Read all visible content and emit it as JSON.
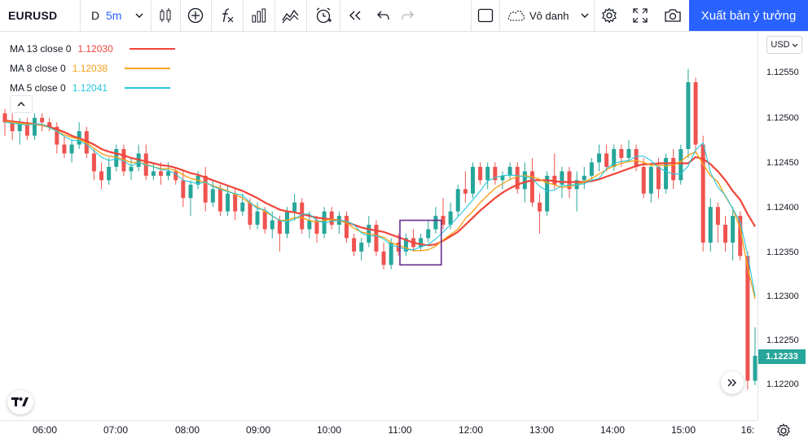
{
  "toolbar": {
    "symbol": "EURUSD",
    "interval_d": "D",
    "interval_5m": "5m",
    "layout_name": "Vô danh",
    "publish_label": "Xuất bản ý tưởng",
    "icons": [
      "candles-icon",
      "add-indicator-icon",
      "fx-icon",
      "bar-chart-icon",
      "compare-icon",
      "alert-clock-icon",
      "replay-icon",
      "undo-icon",
      "redo-icon",
      "square-icon",
      "cloud-icon",
      "settings-icon",
      "fullscreen-icon",
      "camera-icon"
    ]
  },
  "legend": [
    {
      "name": "MA 13 close 0",
      "value": "1.12030",
      "color": "#f0453a"
    },
    {
      "name": "MA 8 close 0",
      "value": "1.12038",
      "color": "#f7a21b"
    },
    {
      "name": "MA 5 close 0",
      "value": "1.12041",
      "color": "#26c6da"
    }
  ],
  "price_axis": {
    "currency": "USD",
    "labels": [
      "1.12550",
      "1.12500",
      "1.12450",
      "1.12400",
      "1.12350",
      "1.12300",
      "1.12250",
      "1.12200"
    ],
    "last_price": "1.12233",
    "last_price_color": "#26a69a"
  },
  "time_axis": {
    "labels": [
      "06:00",
      "07:00",
      "08:00",
      "09:00",
      "10:00",
      "11:00",
      "12:00",
      "13:00",
      "14:00",
      "15:00",
      "16:"
    ]
  },
  "chart_data": {
    "type": "candlestick",
    "symbol": "EURUSD",
    "interval": "5m",
    "ylim": [
      1.1218,
      1.1258
    ],
    "up_color": "#26a69a",
    "down_color": "#ef5350",
    "ohlc": [
      [
        1.12505,
        1.1251,
        1.1248,
        1.12495
      ],
      [
        1.12495,
        1.12505,
        1.12475,
        1.12485
      ],
      [
        1.12485,
        1.125,
        1.1247,
        1.12495
      ],
      [
        1.12495,
        1.125,
        1.12475,
        1.1248
      ],
      [
        1.1248,
        1.12505,
        1.12475,
        1.125
      ],
      [
        1.125,
        1.12505,
        1.12485,
        1.12495
      ],
      [
        1.12495,
        1.125,
        1.12485,
        1.1249
      ],
      [
        1.1249,
        1.12495,
        1.1246,
        1.1247
      ],
      [
        1.1247,
        1.1248,
        1.12455,
        1.1246
      ],
      [
        1.1246,
        1.12475,
        1.1245,
        1.1247
      ],
      [
        1.1247,
        1.12495,
        1.12465,
        1.12485
      ],
      [
        1.12485,
        1.1249,
        1.12455,
        1.1246
      ],
      [
        1.1246,
        1.12465,
        1.1243,
        1.1244
      ],
      [
        1.1244,
        1.1245,
        1.1242,
        1.1243
      ],
      [
        1.1243,
        1.12455,
        1.12425,
        1.12445
      ],
      [
        1.12445,
        1.1247,
        1.1244,
        1.12465
      ],
      [
        1.12465,
        1.1247,
        1.12435,
        1.1244
      ],
      [
        1.1244,
        1.12455,
        1.1243,
        1.12445
      ],
      [
        1.12445,
        1.1247,
        1.1244,
        1.1246
      ],
      [
        1.1246,
        1.1247,
        1.1243,
        1.12435
      ],
      [
        1.12435,
        1.1245,
        1.1243,
        1.1244
      ],
      [
        1.1244,
        1.1245,
        1.12425,
        1.12435
      ],
      [
        1.12435,
        1.1245,
        1.1243,
        1.1244
      ],
      [
        1.1244,
        1.12445,
        1.12425,
        1.1243
      ],
      [
        1.1243,
        1.1244,
        1.124,
        1.1241
      ],
      [
        1.1241,
        1.1243,
        1.1239,
        1.12425
      ],
      [
        1.12425,
        1.1244,
        1.1242,
        1.12435
      ],
      [
        1.12435,
        1.12445,
        1.12395,
        1.12405
      ],
      [
        1.12405,
        1.1243,
        1.124,
        1.1242
      ],
      [
        1.1242,
        1.12425,
        1.1239,
        1.12395
      ],
      [
        1.12395,
        1.12425,
        1.1239,
        1.12415
      ],
      [
        1.12415,
        1.1242,
        1.12385,
        1.12395
      ],
      [
        1.12395,
        1.12415,
        1.1239,
        1.12405
      ],
      [
        1.12405,
        1.1241,
        1.12375,
        1.1238
      ],
      [
        1.1238,
        1.12405,
        1.12375,
        1.12395
      ],
      [
        1.12395,
        1.124,
        1.1237,
        1.12375
      ],
      [
        1.12375,
        1.12395,
        1.12365,
        1.12385
      ],
      [
        1.12385,
        1.1239,
        1.1235,
        1.1237
      ],
      [
        1.1237,
        1.124,
        1.12365,
        1.12395
      ],
      [
        1.12395,
        1.12415,
        1.12385,
        1.12405
      ],
      [
        1.12405,
        1.1241,
        1.1237,
        1.12375
      ],
      [
        1.12375,
        1.12395,
        1.12365,
        1.12385
      ],
      [
        1.12385,
        1.1239,
        1.1236,
        1.1237
      ],
      [
        1.1237,
        1.124,
        1.12365,
        1.12395
      ],
      [
        1.12395,
        1.124,
        1.12375,
        1.1238
      ],
      [
        1.1238,
        1.12395,
        1.1237,
        1.1239
      ],
      [
        1.1239,
        1.12395,
        1.1236,
        1.12365
      ],
      [
        1.12365,
        1.1237,
        1.12345,
        1.1235
      ],
      [
        1.1235,
        1.12365,
        1.1234,
        1.1236
      ],
      [
        1.1236,
        1.1239,
        1.12355,
        1.1238
      ],
      [
        1.1238,
        1.12385,
        1.12345,
        1.1235
      ],
      [
        1.1235,
        1.1236,
        1.1233,
        1.12335
      ],
      [
        1.12335,
        1.12365,
        1.1233,
        1.1236
      ],
      [
        1.1236,
        1.1237,
        1.12345,
        1.1235
      ],
      [
        1.1235,
        1.1237,
        1.12345,
        1.12365
      ],
      [
        1.12365,
        1.12375,
        1.1235,
        1.12355
      ],
      [
        1.12355,
        1.1237,
        1.1235,
        1.12365
      ],
      [
        1.12365,
        1.12385,
        1.1236,
        1.12375
      ],
      [
        1.12375,
        1.124,
        1.1237,
        1.1239
      ],
      [
        1.1239,
        1.1241,
        1.12375,
        1.1238
      ],
      [
        1.1238,
        1.12405,
        1.12375,
        1.12395
      ],
      [
        1.12395,
        1.12425,
        1.1239,
        1.1242
      ],
      [
        1.1242,
        1.1244,
        1.12405,
        1.12415
      ],
      [
        1.12415,
        1.1245,
        1.1241,
        1.12445
      ],
      [
        1.12445,
        1.1245,
        1.12425,
        1.1243
      ],
      [
        1.1243,
        1.1245,
        1.1242,
        1.12445
      ],
      [
        1.12445,
        1.1245,
        1.12425,
        1.1243
      ],
      [
        1.1243,
        1.1244,
        1.1242,
        1.12435
      ],
      [
        1.12435,
        1.1245,
        1.1243,
        1.12445
      ],
      [
        1.12445,
        1.1245,
        1.12415,
        1.1242
      ],
      [
        1.1242,
        1.1245,
        1.12405,
        1.1244
      ],
      [
        1.1244,
        1.12455,
        1.124,
        1.12405
      ],
      [
        1.12405,
        1.12415,
        1.1237,
        1.12395
      ],
      [
        1.12395,
        1.1244,
        1.1239,
        1.12435
      ],
      [
        1.12435,
        1.1246,
        1.1242,
        1.12425
      ],
      [
        1.12425,
        1.12445,
        1.1241,
        1.1244
      ],
      [
        1.1244,
        1.12445,
        1.1241,
        1.1242
      ],
      [
        1.1242,
        1.1244,
        1.12395,
        1.1243
      ],
      [
        1.1243,
        1.12445,
        1.1242,
        1.12435
      ],
      [
        1.12435,
        1.12455,
        1.1243,
        1.1245
      ],
      [
        1.1245,
        1.1247,
        1.1244,
        1.1246
      ],
      [
        1.1246,
        1.1247,
        1.1244,
        1.12445
      ],
      [
        1.12445,
        1.1247,
        1.1244,
        1.12465
      ],
      [
        1.12465,
        1.1247,
        1.12445,
        1.12455
      ],
      [
        1.12455,
        1.12475,
        1.1245,
        1.12465
      ],
      [
        1.12465,
        1.1247,
        1.1244,
        1.12445
      ],
      [
        1.12445,
        1.12455,
        1.1241,
        1.12415
      ],
      [
        1.12415,
        1.1245,
        1.12405,
        1.12445
      ],
      [
        1.12445,
        1.12455,
        1.1241,
        1.1242
      ],
      [
        1.1242,
        1.1246,
        1.12415,
        1.12455
      ],
      [
        1.12455,
        1.12465,
        1.1242,
        1.1243
      ],
      [
        1.1243,
        1.1247,
        1.12425,
        1.12465
      ],
      [
        1.12465,
        1.12555,
        1.12455,
        1.1254
      ],
      [
        1.1254,
        1.12545,
        1.1246,
        1.1247
      ],
      [
        1.1247,
        1.1248,
        1.1235,
        1.1236
      ],
      [
        1.1236,
        1.1241,
        1.1235,
        1.124
      ],
      [
        1.124,
        1.12405,
        1.1236,
        1.1238
      ],
      [
        1.1238,
        1.1239,
        1.1235,
        1.1236
      ],
      [
        1.1236,
        1.124,
        1.1234,
        1.1239
      ],
      [
        1.1239,
        1.12395,
        1.1234,
        1.12345
      ],
      [
        1.12345,
        1.1235,
        1.12195,
        1.12205
      ],
      [
        1.12205,
        1.12265,
        1.122,
        1.12233
      ]
    ],
    "ma": [
      {
        "name": "MA 13 close 0",
        "color": "#f0453a",
        "values": [
          1.12497,
          1.12496,
          1.12495,
          1.12494,
          1.12493,
          1.12492,
          1.1249,
          1.12487,
          1.12484,
          1.1248,
          1.12477,
          1.12474,
          1.1247,
          1.12465,
          1.12462,
          1.1246,
          1.12458,
          1.12455,
          1.12453,
          1.12451,
          1.12449,
          1.12447,
          1.12446,
          1.12444,
          1.12441,
          1.12438,
          1.12436,
          1.12433,
          1.1243,
          1.12427,
          1.12424,
          1.12421,
          1.12418,
          1.12414,
          1.1241,
          1.12405,
          1.12401,
          1.12397,
          1.12395,
          1.12394,
          1.12392,
          1.1239,
          1.12388,
          1.12387,
          1.12386,
          1.12385,
          1.12383,
          1.1238,
          1.12377,
          1.12375,
          1.12372,
          1.12369,
          1.12366,
          1.12363,
          1.1236,
          1.12358,
          1.12357,
          1.12358,
          1.12362,
          1.12367,
          1.12372,
          1.1238,
          1.12388,
          1.12396,
          1.12403,
          1.1241,
          1.12416,
          1.12421,
          1.12425,
          1.12428,
          1.1243,
          1.1243,
          1.1243,
          1.12429,
          1.12428,
          1.12428,
          1.12428,
          1.12428,
          1.12429,
          1.12431,
          1.12434,
          1.12437,
          1.1244,
          1.12443,
          1.12446,
          1.12448,
          1.12448,
          1.12449,
          1.12449,
          1.12449,
          1.12449,
          1.12449,
          1.12456,
          1.12454,
          1.12448,
          1.1244,
          1.1243,
          1.12418,
          1.12408,
          1.12392,
          1.12378
        ]
      },
      {
        "name": "MA 8 close 0",
        "color": "#f7a21b",
        "values": [
          1.12496,
          1.12495,
          1.12494,
          1.12493,
          1.12493,
          1.12492,
          1.12489,
          1.12485,
          1.12481,
          1.12478,
          1.12476,
          1.12472,
          1.12466,
          1.1246,
          1.12457,
          1.12456,
          1.12453,
          1.1245,
          1.1245,
          1.12448,
          1.12445,
          1.12443,
          1.12443,
          1.12441,
          1.12436,
          1.12432,
          1.1243,
          1.12427,
          1.12424,
          1.12421,
          1.12418,
          1.12414,
          1.1241,
          1.12404,
          1.124,
          1.12395,
          1.1239,
          1.12385,
          1.12385,
          1.12388,
          1.12388,
          1.12385,
          1.12383,
          1.12385,
          1.12386,
          1.12385,
          1.12382,
          1.12376,
          1.12372,
          1.1237,
          1.12366,
          1.1236,
          1.12357,
          1.12354,
          1.12351,
          1.12351,
          1.12352,
          1.12356,
          1.12363,
          1.12369,
          1.12375,
          1.12387,
          1.12395,
          1.12405,
          1.12413,
          1.12421,
          1.12426,
          1.12431,
          1.12434,
          1.12435,
          1.12434,
          1.12431,
          1.12427,
          1.12425,
          1.12422,
          1.12423,
          1.12425,
          1.12428,
          1.12432,
          1.12437,
          1.12442,
          1.12446,
          1.12449,
          1.12451,
          1.12452,
          1.1245,
          1.12447,
          1.12447,
          1.12446,
          1.12447,
          1.12451,
          1.12458,
          1.12462,
          1.12448,
          1.12435,
          1.12428,
          1.12412,
          1.12398,
          1.12376,
          1.12332,
          1.12297
        ]
      },
      {
        "name": "MA 5 close 0",
        "color": "#26c6da",
        "values": [
          1.12495,
          1.12494,
          1.12493,
          1.12492,
          1.12493,
          1.12493,
          1.12489,
          1.12485,
          1.12479,
          1.12475,
          1.12474,
          1.1247,
          1.12463,
          1.12456,
          1.12452,
          1.12454,
          1.12452,
          1.12446,
          1.1245,
          1.12447,
          1.12445,
          1.12442,
          1.12441,
          1.12437,
          1.1243,
          1.12426,
          1.12428,
          1.12423,
          1.1242,
          1.12417,
          1.12415,
          1.12413,
          1.12405,
          1.12398,
          1.12397,
          1.1239,
          1.12385,
          1.12383,
          1.12386,
          1.12392,
          1.12392,
          1.12385,
          1.12382,
          1.12384,
          1.12385,
          1.12384,
          1.1238,
          1.12371,
          1.12367,
          1.12368,
          1.12364,
          1.12357,
          1.12355,
          1.12352,
          1.12352,
          1.12355,
          1.12358,
          1.12364,
          1.12372,
          1.1238,
          1.12389,
          1.12398,
          1.12408,
          1.12418,
          1.12429,
          1.12433,
          1.12435,
          1.12436,
          1.12435,
          1.12434,
          1.12432,
          1.12423,
          1.12418,
          1.12419,
          1.12424,
          1.12425,
          1.12426,
          1.1243,
          1.12432,
          1.12443,
          1.12449,
          1.12451,
          1.12452,
          1.12457,
          1.12457,
          1.12452,
          1.12444,
          1.1244,
          1.12437,
          1.12437,
          1.12446,
          1.12464,
          1.12472,
          1.12439,
          1.12422,
          1.12413,
          1.12398,
          1.12383,
          1.12346,
          1.123
        ]
      }
    ],
    "annotations": [
      {
        "type": "rectangle",
        "color": "#6a2c91",
        "x_from": "11:00",
        "x_to": "11:35",
        "y_from": 1.12335,
        "y_to": 1.12385
      }
    ]
  }
}
